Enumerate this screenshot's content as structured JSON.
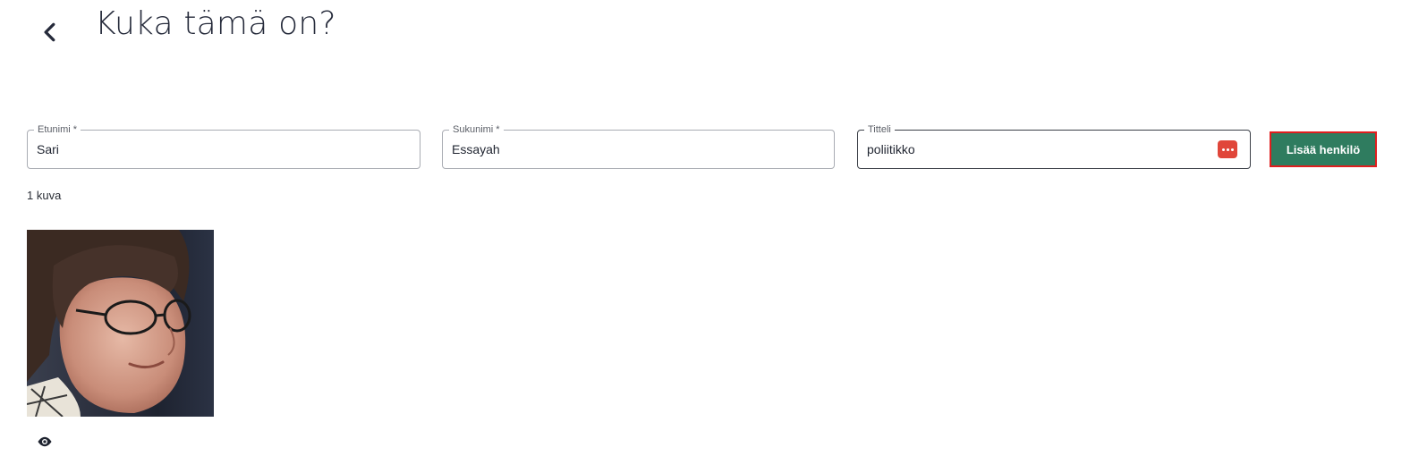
{
  "header": {
    "back_icon": "chevron-left-icon",
    "title": "Kuka tämä on?"
  },
  "form": {
    "first_name": {
      "label": "Etunimi *",
      "value": "Sari"
    },
    "last_name": {
      "label": "Sukunimi *",
      "value": "Essayah"
    },
    "title": {
      "label": "Titteli",
      "value": "poliitikko",
      "icon": "password-manager-icon",
      "icon_color": "#e0463a"
    },
    "add_button_label": "Lisää henkilö"
  },
  "results": {
    "count_text": "1 kuva",
    "view_icon": "eye-icon"
  },
  "colors": {
    "accent": "#2e7d5e",
    "highlight_border": "#e01e1e"
  }
}
